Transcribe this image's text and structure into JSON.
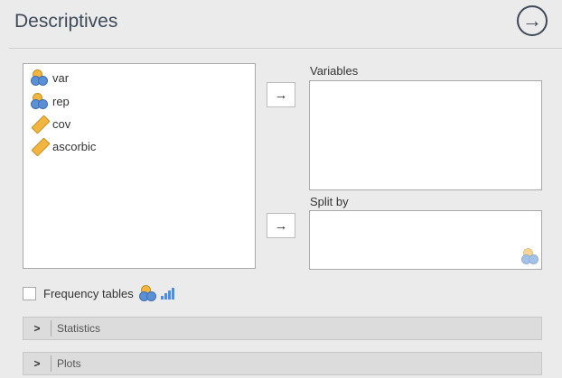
{
  "header": {
    "title": "Descriptives",
    "run_icon": "arrow-right-circle-icon",
    "run_symbol": "→"
  },
  "source_list": {
    "items": [
      {
        "label": "var",
        "icon": "nominal-icon"
      },
      {
        "label": "rep",
        "icon": "nominal-icon"
      },
      {
        "label": "cov",
        "icon": "continuous-icon"
      },
      {
        "label": "ascorbic",
        "icon": "continuous-icon"
      }
    ]
  },
  "targets": {
    "variables_label": "Variables",
    "split_label": "Split by",
    "move_symbol": "→"
  },
  "options": {
    "frequency_tables_label": "Frequency tables",
    "frequency_tables_checked": false
  },
  "sections": {
    "statistics_label": "Statistics",
    "plots_label": "Plots",
    "chevron": ">"
  },
  "colors": {
    "nominal_orange": "#f2b640",
    "nominal_blue": "#5b8fd6",
    "bars_blue": "#4a90e2",
    "title": "#3e4a57"
  }
}
